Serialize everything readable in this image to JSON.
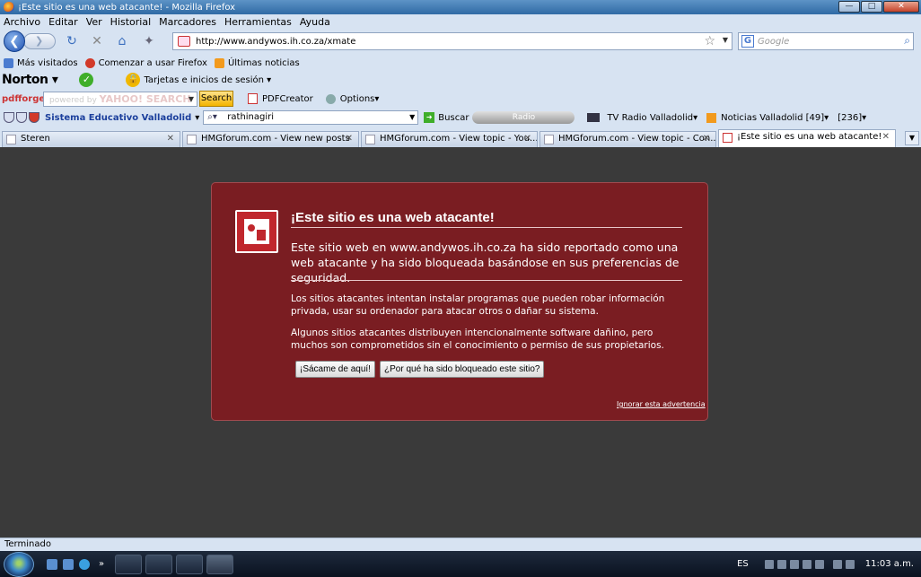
{
  "window": {
    "title": "¡Este sitio es una web atacante! - Mozilla Firefox",
    "minimize": "—",
    "maximize": "□",
    "close": "✕"
  },
  "menu": [
    "Archivo",
    "Editar",
    "Ver",
    "Historial",
    "Marcadores",
    "Herramientas",
    "Ayuda"
  ],
  "nav": {
    "back": "❮",
    "forward": "❯",
    "reload": "↻",
    "stop": "✕",
    "home": "⌂",
    "url": "http://www.andywos.ih.co.za/xmate",
    "search_placeholder": "Google",
    "search_engine_letter": "G"
  },
  "bookmarks": [
    {
      "label": "Más visitados",
      "color": "#4a7bd0"
    },
    {
      "label": "Comenzar a usar Firefox",
      "color": "#d23a2a"
    },
    {
      "label": "Últimas noticias",
      "color": "#f29a1d"
    }
  ],
  "norton": {
    "brand": "Norton",
    "identity_safe": "Tarjetas e inicios de sesión"
  },
  "pdfforge": {
    "brand": "pdfforge",
    "search_powered": "powered by",
    "search_yahoo": "YAHOO! SEARCH",
    "search_button": "Search",
    "pdfcreator": "PDFCreator",
    "options": "Options"
  },
  "toolbar3": {
    "site": "Sistema Educativo Valladolid",
    "query": "rathinagiri",
    "search_button": "Buscar",
    "radio": "Radio",
    "tv": "TV Radio Valladolid",
    "news": "Noticias Valladolid [49]",
    "count": "[236]"
  },
  "tabs": [
    {
      "label": "Steren",
      "width": 198,
      "active": false
    },
    {
      "label": "HMGforum.com - View new posts",
      "width": 198,
      "active": false
    },
    {
      "label": "HMGforum.com - View topic - You...",
      "width": 198,
      "active": false
    },
    {
      "label": "HMGforum.com - View topic - Con...",
      "width": 198,
      "active": false
    },
    {
      "label": "¡Este sitio es una web atacante!",
      "width": 198,
      "active": true
    }
  ],
  "warning": {
    "title": "¡Este sitio es una web atacante!",
    "description": "Este sitio web en www.andywos.ih.co.za ha sido reportado como una web atacante y ha sido bloqueada basándose en sus preferencias de seguridad.",
    "paragraph1": "Los sitios atacantes intentan instalar programas que pueden robar información privada, usar su ordenador para atacar otros o dañar su sistema.",
    "paragraph2": "Algunos sitios atacantes distribuyen intencionalmente software dañino, pero muchos son comprometidos sin el conocimiento o permiso de sus propietarios.",
    "get_me_out": "¡Sácame de aquí!",
    "why_blocked": "¿Por qué ha sido bloqueado este sitio?",
    "ignore": "Ignorar esta advertencia"
  },
  "status": "Terminado",
  "taskbar": {
    "lang": "ES",
    "time": "11:03 a.m."
  }
}
